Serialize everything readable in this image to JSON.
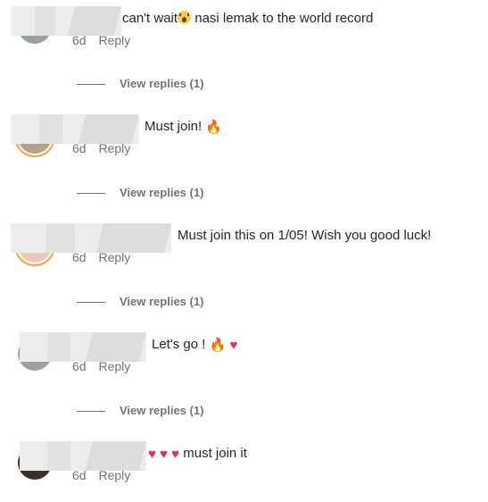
{
  "comments": [
    {
      "text_before": "can't wait",
      "emoji": "screaming-face-emoji",
      "text_after": " nasi lemak to the world record",
      "time": "6d",
      "reply_label": "Reply",
      "view_replies": "View replies (1)"
    },
    {
      "text": "Must join! ",
      "emoji": "fire-emoji",
      "time": "6d",
      "reply_label": "Reply",
      "view_replies": "View replies (1)"
    },
    {
      "text": "Must join this on 1/05! Wish you good luck!",
      "time": "6d",
      "reply_label": "Reply",
      "view_replies": "View replies (1)"
    },
    {
      "text": "Let's go ! ",
      "emojis": [
        "fire-emoji",
        "red-heart-emoji"
      ],
      "time": "6d",
      "reply_label": "Reply",
      "view_replies": "View replies (1)"
    },
    {
      "emojis": [
        "red-heart-emoji",
        "red-heart-emoji",
        "red-heart-emoji"
      ],
      "text": " must join it",
      "time": "6d",
      "reply_label": "Reply"
    }
  ],
  "colors": {
    "text": "#262626",
    "secondary": "#737373",
    "story_ring": "#f9a23b",
    "heart": "#f02859",
    "fire": "#f26b1d"
  }
}
